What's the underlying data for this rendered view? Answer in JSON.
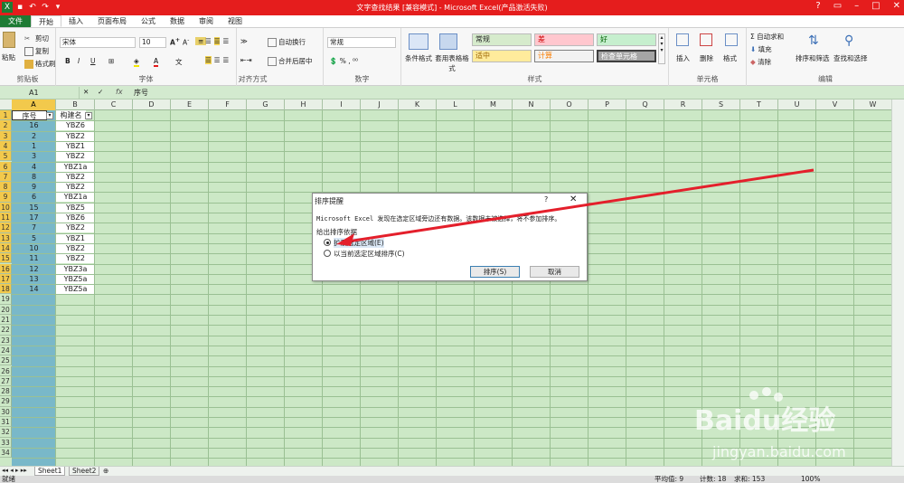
{
  "window": {
    "title": "文字查找结果 [兼容模式] - Microsoft Excel(产品激活失败)"
  },
  "tabs": [
    "文件",
    "开始",
    "插入",
    "页面布局",
    "公式",
    "数据",
    "审阅",
    "视图"
  ],
  "ribbon": {
    "clipboard": {
      "paste": "粘贴",
      "cut": "剪切",
      "copy": "复制",
      "format_painter": "格式刷",
      "label": "剪贴板"
    },
    "font": {
      "name": "宋体",
      "size": "10",
      "label": "字体"
    },
    "alignment": {
      "wrap": "自动换行",
      "merge": "合并后居中",
      "label": "对齐方式"
    },
    "number": {
      "format": "常规",
      "label": "数字"
    },
    "styles": {
      "conditional": "条件格式",
      "table": "套用表格格式",
      "cells": [
        "常规",
        "差",
        "好",
        "适中",
        "计算",
        "检查单元格"
      ],
      "label": "样式"
    },
    "cells": {
      "insert": "插入",
      "delete": "删除",
      "format": "格式",
      "label": "单元格"
    },
    "editing": {
      "autosum": "自动求和",
      "fill": "填充",
      "clear": "清除",
      "sort": "排序和筛选",
      "find": "查找和选择",
      "label": "编辑"
    }
  },
  "formula": {
    "namebox": "A1",
    "fx": "fx",
    "content": "序号"
  },
  "columns": [
    "A",
    "B",
    "C",
    "D",
    "E",
    "F",
    "G",
    "H",
    "I",
    "J",
    "K",
    "L",
    "M",
    "N",
    "O",
    "P",
    "Q",
    "R",
    "S",
    "T",
    "U",
    "V",
    "W"
  ],
  "header_row": {
    "a": "序号",
    "b": "构建名"
  },
  "rows": [
    {
      "a": "16",
      "b": "YBZ6"
    },
    {
      "a": "2",
      "b": "YBZ2"
    },
    {
      "a": "1",
      "b": "YBZ1"
    },
    {
      "a": "3",
      "b": "YBZ2"
    },
    {
      "a": "4",
      "b": "YBZ1a"
    },
    {
      "a": "8",
      "b": "YBZ2"
    },
    {
      "a": "9",
      "b": "YBZ2"
    },
    {
      "a": "6",
      "b": "YBZ1a"
    },
    {
      "a": "15",
      "b": "YBZ5"
    },
    {
      "a": "17",
      "b": "YBZ6"
    },
    {
      "a": "7",
      "b": "YBZ2"
    },
    {
      "a": "5",
      "b": "YBZ1"
    },
    {
      "a": "10",
      "b": "YBZ2"
    },
    {
      "a": "11",
      "b": "YBZ2"
    },
    {
      "a": "12",
      "b": "YBZ3a"
    },
    {
      "a": "13",
      "b": "YBZ5a"
    },
    {
      "a": "14",
      "b": "YBZ5a"
    }
  ],
  "row_count": 34,
  "dialog": {
    "title": "排序提醒",
    "help": "?",
    "close": "✕",
    "message": "Microsoft Excel 发现在选定区域旁边还有数据。该数据未被选择，将不参加排序。",
    "group": "给出排序依据",
    "option1": "扩展选定区域(E)",
    "option2": "以当前选定区域排序(C)",
    "sort_btn": "排序(S)",
    "cancel_btn": "取消"
  },
  "sheets": [
    "Sheet1",
    "Sheet2"
  ],
  "status": {
    "ready": "就绪",
    "average": "平均值: 9",
    "count": "计数: 18",
    "sum": "求和: 153",
    "zoom": "100%"
  },
  "watermark": {
    "brand": "Baidu经验",
    "url": "jingyan.baidu.com"
  }
}
